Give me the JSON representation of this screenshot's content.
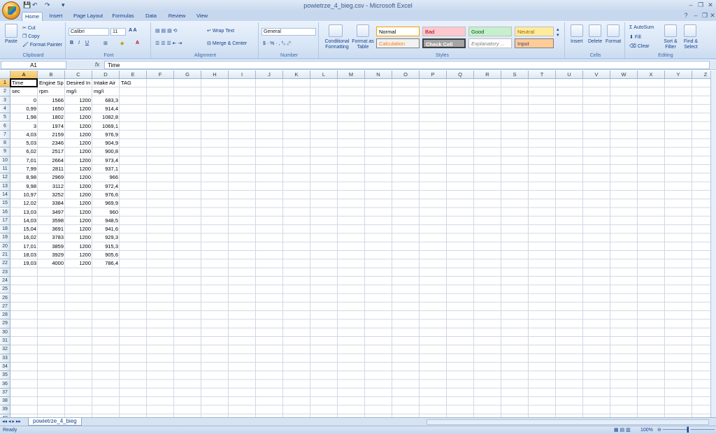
{
  "window": {
    "title": "powietrze_4_bieg.csv - Microsoft Excel"
  },
  "tabs": [
    "Home",
    "Insert",
    "Page Layout",
    "Formulas",
    "Data",
    "Review",
    "View"
  ],
  "ribbon": {
    "clipboard": {
      "label": "Clipboard",
      "paste": "Paste",
      "cut": "Cut",
      "copy": "Copy",
      "format_painter": "Format Painter"
    },
    "font": {
      "label": "Font",
      "name": "Calibri",
      "size": "11"
    },
    "alignment": {
      "label": "Alignment",
      "wrap": "Wrap Text",
      "merge": "Merge & Center"
    },
    "number": {
      "label": "Number",
      "format": "General"
    },
    "styles": {
      "label": "Styles",
      "cond": "Conditional Formatting",
      "format_table": "Format as Table",
      "normal": "Normal",
      "bad": "Bad",
      "good": "Good",
      "neutral": "Neutral",
      "calculation": "Calculation",
      "check_cell": "Check Cell",
      "explanatory": "Explanatory ...",
      "input": "Input"
    },
    "cells": {
      "label": "Cells",
      "insert": "Insert",
      "delete": "Delete",
      "format": "Format"
    },
    "editing": {
      "label": "Editing",
      "autosum": "AutoSum",
      "fill": "Fill",
      "clear": "Clear",
      "sort": "Sort & Filter",
      "find": "Find & Select"
    }
  },
  "formula_bar": {
    "name_box": "A1",
    "fx": "fx",
    "value": "Time"
  },
  "columns": [
    "A",
    "B",
    "C",
    "D",
    "E",
    "F",
    "G",
    "H",
    "I",
    "J",
    "K",
    "L",
    "M",
    "N",
    "O",
    "P",
    "Q",
    "R",
    "S",
    "T",
    "U",
    "V",
    "W",
    "X",
    "Y",
    "Z"
  ],
  "header_row": [
    "Time",
    "Engine Sp",
    "Desired In",
    "Intake Air",
    "TAG"
  ],
  "units_row": [
    "sec",
    "rpm",
    "mg/i",
    "mg/i"
  ],
  "data_rows": [
    [
      "0",
      "1566",
      "1200",
      "683,3"
    ],
    [
      "0,99",
      "1650",
      "1200",
      "914,4"
    ],
    [
      "1,98",
      "1802",
      "1200",
      "1082,8"
    ],
    [
      "3",
      "1974",
      "1200",
      "1069,1"
    ],
    [
      "4,03",
      "2159",
      "1200",
      "976,9"
    ],
    [
      "5,03",
      "2346",
      "1200",
      "904,9"
    ],
    [
      "6,02",
      "2517",
      "1200",
      "900,8"
    ],
    [
      "7,01",
      "2664",
      "1200",
      "973,4"
    ],
    [
      "7,99",
      "2811",
      "1200",
      "937,1"
    ],
    [
      "8,98",
      "2969",
      "1200",
      "966"
    ],
    [
      "9,98",
      "3112",
      "1200",
      "972,4"
    ],
    [
      "10,97",
      "3252",
      "1200",
      "976,6"
    ],
    [
      "12,02",
      "3384",
      "1200",
      "969,9"
    ],
    [
      "13,03",
      "3497",
      "1200",
      "960"
    ],
    [
      "14,03",
      "3598",
      "1200",
      "948,5"
    ],
    [
      "15,04",
      "3691",
      "1200",
      "941,6"
    ],
    [
      "16,02",
      "3783",
      "1200",
      "929,3"
    ],
    [
      "17,01",
      "3859",
      "1200",
      "915,3"
    ],
    [
      "18,03",
      "3929",
      "1200",
      "905,6"
    ],
    [
      "19,03",
      "4000",
      "1200",
      "786,4"
    ]
  ],
  "visible_rows": 40,
  "sheet": {
    "name": "powietrze_4_bieg"
  },
  "status": {
    "text": "Ready",
    "zoom": "100%"
  }
}
